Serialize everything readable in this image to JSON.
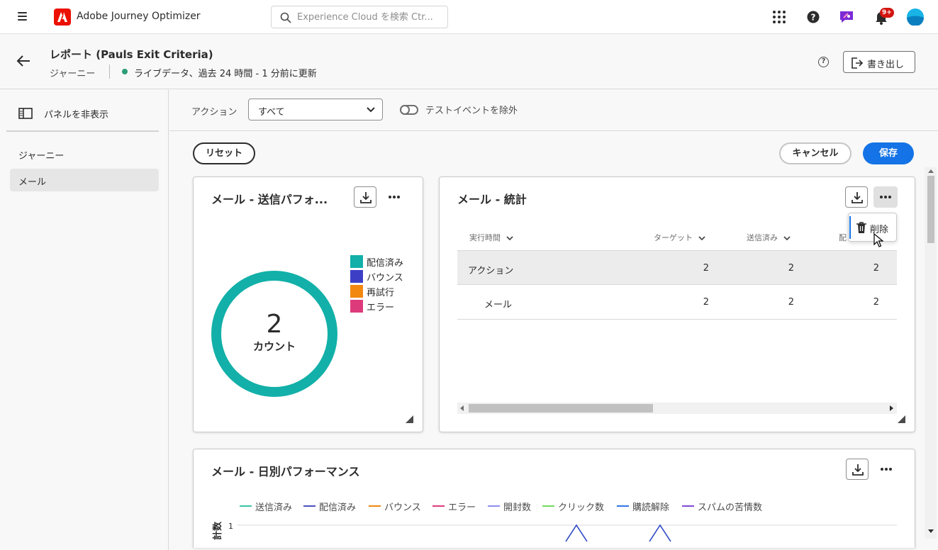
{
  "app": {
    "name": "Adobe Journey Optimizer"
  },
  "search": {
    "placeholder": "Experience Cloud を検索 Ctr..."
  },
  "notifications": {
    "badge": "9+"
  },
  "header": {
    "title": "レポート (Pauls Exit Criteria)",
    "breadcrumb": "ジャーニー",
    "status": "ライブデータ、過去 24 時間 - 1 分前に更新",
    "export_label": "書き出し",
    "help_icon": "?"
  },
  "sidebar": {
    "hide_panel_label": "パネルを非表示",
    "items": [
      {
        "label": "ジャーニー"
      },
      {
        "label": "メール"
      }
    ]
  },
  "filters": {
    "action_label": "アクション",
    "action_value": "すべて",
    "toggle_label": "テストイベントを除外"
  },
  "buttons": {
    "reset": "リセット",
    "cancel": "キャンセル",
    "save": "保存"
  },
  "cards": {
    "send_performance": {
      "title": "メール - 送信パフォ...",
      "donut_value": "2",
      "donut_label": "カウント",
      "legend": [
        {
          "label": "配信済み",
          "color": "#12b0a8"
        },
        {
          "label": "バウンス",
          "color": "#3c3fc6"
        },
        {
          "label": "再試行",
          "color": "#f2880f"
        },
        {
          "label": "エラー",
          "color": "#dd3a7c"
        }
      ]
    },
    "stats": {
      "title": "メール - 統計",
      "columns": [
        "実行時間",
        "ターゲット",
        "送信済み",
        "配"
      ],
      "rows": [
        {
          "name": "アクション",
          "values": [
            "2",
            "2",
            "2"
          ]
        },
        {
          "name": "メール",
          "values": [
            "2",
            "2",
            "2"
          ]
        }
      ],
      "menu_delete": "削除"
    },
    "daily": {
      "title": "メール - 日別パフォーマンス",
      "ylabel": "計数",
      "y_tick": "1",
      "legend": [
        {
          "label": "送信済み",
          "color": "#3cc3a5"
        },
        {
          "label": "配信済み",
          "color": "#4c4fbd"
        },
        {
          "label": "バウンス",
          "color": "#f2880f"
        },
        {
          "label": "エラー",
          "color": "#dd3a7c"
        },
        {
          "label": "開封数",
          "color": "#8f8ef0"
        },
        {
          "label": "クリック数",
          "color": "#72da5c"
        },
        {
          "label": "購読解除",
          "color": "#2f74e8"
        },
        {
          "label": "スパムの苦情数",
          "color": "#7e4bd5"
        }
      ]
    }
  },
  "chart_data": {
    "type": "line",
    "title": "メール - 日別パフォーマンス",
    "ylabel": "計数",
    "ylim": [
      0,
      1
    ],
    "y_ticks": [
      "1"
    ],
    "series": [
      {
        "name": "送信済み"
      },
      {
        "name": "配信済み"
      },
      {
        "name": "バウンス"
      },
      {
        "name": "エラー"
      },
      {
        "name": "開封数"
      },
      {
        "name": "クリック数"
      },
      {
        "name": "購読解除"
      },
      {
        "name": "スパムの苦情数"
      }
    ]
  }
}
